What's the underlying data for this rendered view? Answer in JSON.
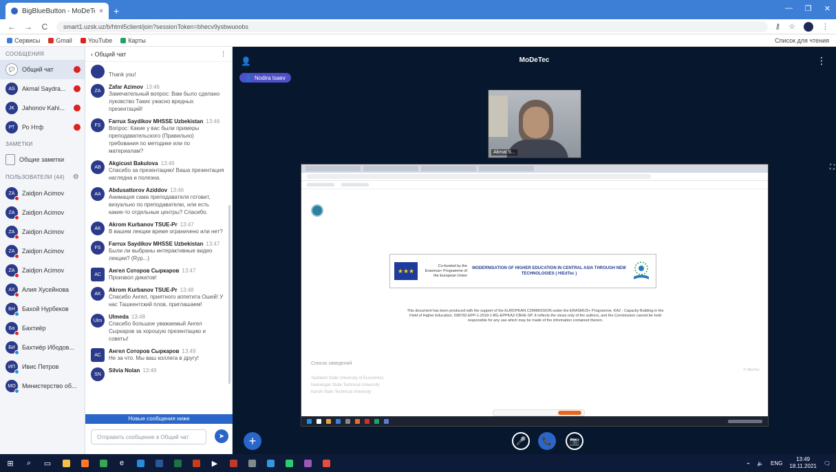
{
  "browser": {
    "tab_title": "BigBlueButton - MoDeTec",
    "tab_close": "×",
    "new_tab": "+",
    "url": "smart1.uzsk.uz/b/html5client/join?sessionToken=bhecv9ysbwuoobs",
    "back": "←",
    "forward": "→",
    "reload": "C",
    "window_controls": [
      "—",
      "❐",
      "✕"
    ],
    "bookmarks": [
      {
        "label": "Сервисы",
        "color": "#3b7ddd"
      },
      {
        "label": "Gmail",
        "color": "#d93025"
      },
      {
        "label": "YouTube",
        "color": "#e02020"
      },
      {
        "label": "Карты",
        "color": "#1ea362"
      }
    ],
    "bookmarks_right": "Список для чтения"
  },
  "sidebar": {
    "messages_header": "СООБЩЕНИЯ",
    "chats": [
      {
        "label": "Общий чат",
        "initials": "",
        "active": true
      },
      {
        "label": "Akmal Saydra...",
        "initials": "AS",
        "active": false
      },
      {
        "label": "Jahonov Kahi...",
        "initials": "JK",
        "active": false
      },
      {
        "label": "Ро Нтф",
        "initials": "РТ",
        "active": false
      }
    ],
    "notes_header": "ЗАМЕТКИ",
    "notes_item": "Общие заметки",
    "users_header": "ПОЛЬЗОВАТЕЛИ (44)",
    "users": [
      {
        "label": "Zaidjon Acimov",
        "initials": "ZA",
        "mark": "red"
      },
      {
        "label": "Zaidjon Acimov",
        "initials": "ZA",
        "mark": "red"
      },
      {
        "label": "Zaidjon Acimov",
        "initials": "ZA",
        "mark": "red"
      },
      {
        "label": "Zaidjon Acimov",
        "initials": "ZA",
        "mark": "red"
      },
      {
        "label": "Zaidjon Acimov",
        "initials": "ZA",
        "mark": "red"
      },
      {
        "label": "Алия Хусейнова",
        "initials": "АХ",
        "mark": "red"
      },
      {
        "label": "Бахой Нурбеков",
        "initials": "БН",
        "mark": "blue"
      },
      {
        "label": "Бахтиёр",
        "initials": "Ба",
        "mark": "red"
      },
      {
        "label": "Бахтиёр Ибодов...",
        "initials": "БИ",
        "mark": "blue"
      },
      {
        "label": "Ивис Петров",
        "initials": "ИП",
        "mark": "blue"
      },
      {
        "label": "Министерство об...",
        "initials": "МО",
        "mark": "blue"
      }
    ]
  },
  "chat": {
    "header": "‹ Общий чат",
    "menu": "⋮",
    "messages": [
      {
        "name": "",
        "initials": "",
        "time": "",
        "text": "Thank you!",
        "square": false
      },
      {
        "name": "Zafar Azimov",
        "initials": "ZA",
        "time": "13:46",
        "text": "Замечательный вопрос: Вам было сделано луковство Таких ужасно вредных презентаций!",
        "square": false
      },
      {
        "name": "Farrux Saydikov MHSSE Uzbekistan",
        "initials": "FS",
        "time": "13:46",
        "text": "Вопрос: Какие у вас были примеры преподавательского (Правильно) требования по методике или по материалам?",
        "square": false
      },
      {
        "name": "Akgicust Bakulova",
        "initials": "AB",
        "time": "13:46",
        "text": "Спасибо за презентацию! Ваша презентация наглядна и полезна.",
        "square": false
      },
      {
        "name": "Abdusattorov Aziddov",
        "initials": "AA",
        "time": "13:46",
        "text": "Анимация сама преподавателя готовит, визуально по преподавателю, или есть какие-то отдельные центры? Спасибо.",
        "square": false
      },
      {
        "name": "Akrom Kurbanov TSUE-Pr",
        "initials": "AK",
        "time": "13:47",
        "text": "В вашем лекции время ограничено или нет?",
        "square": false
      },
      {
        "name": "Farrux Saydikov MHSSE Uzbekistan",
        "initials": "FS",
        "time": "13:47",
        "text": "Были ли выбраны интерактивные видео лекции? (Ryp...)",
        "square": false
      },
      {
        "name": "Ангел Соторов Сыркаров",
        "initials": "АС",
        "time": "13:47",
        "text": "Произвол дикатов!",
        "square": true
      },
      {
        "name": "Akrom Kurbanov TSUE-Pr",
        "initials": "AK",
        "time": "13:48",
        "text": "Спасибо Ангел, приятного аппетита Ошей! У нас Ташкентский плов, приглашаем!",
        "square": false
      },
      {
        "name": "Ulmeda",
        "initials": "Ulm",
        "time": "13:48",
        "text": "Спасибо большое уважаемый Ангел Сыркаров за хорошую презентацию и советы!",
        "square": false
      },
      {
        "name": "Ангел Соторов Сыркаров",
        "initials": "АС",
        "time": "13:49",
        "text": "Не за что. Мы ваш коллега в другу!",
        "square": true
      },
      {
        "name": "Silvia Nolan",
        "initials": "SN",
        "time": "13:49",
        "text": "",
        "square": false
      }
    ],
    "new_messages_bar": "Новые сообщения ниже",
    "composer_placeholder": "Отправить сообщение в Общий чат",
    "send_icon": "➤"
  },
  "stage": {
    "title": "MoDeTec",
    "presenter_badge": "Nodira Isaev",
    "users_icon": "👤",
    "kebab": "⋮",
    "webcam_label": "Akmal S...",
    "fullscreen_icon": "⛶",
    "plus_button": "+",
    "controls": [
      {
        "icon": "🎤",
        "style": "outline"
      },
      {
        "icon": "📞",
        "style": "filled"
      },
      {
        "icon": "📷",
        "style": "outline"
      }
    ]
  },
  "shared_screen": {
    "eu_flag": "★★★",
    "eu_text": "Co-funded by the Erasmus+ Programme of the European Union",
    "project_title": "MODERNISATION OF HIGHER EDUCATION IN CENTRAL ASIA THROUGH NEW TECHNOLOGIES ( HiEdTec )",
    "disclaimer": "This document has been produced with the support of the EUROPEAN COMMISSION under the ERASMUS+ Programme, KA2 - Capacity Building in the Field of Higher Education. 598792-EPP-1-2018-1-BG-EPPKA2-CBHE-SP. It reflects the views only of the authors, and the Commission cannot be held responsible for any use which may be made of the information contained therein.",
    "faded_head": "Список заведений",
    "faded_right": "© HiEdTec",
    "faded_list": [
      "Tashkent State University of Economics",
      "Namangan State Technical University",
      "Karshi State Technical University"
    ]
  },
  "taskbar": {
    "time": "13:49",
    "date": "18.11.2021",
    "lang": "ENG",
    "icons": [
      {
        "name": "search-icon",
        "glyph": "⌕",
        "color": ""
      },
      {
        "name": "task-view-icon",
        "glyph": "▭",
        "color": ""
      },
      {
        "name": "explorer-icon",
        "glyph": "",
        "color": "#f5c04a"
      },
      {
        "name": "firefox-icon",
        "glyph": "",
        "color": "#ff7a2b"
      },
      {
        "name": "chrome-icon",
        "glyph": "",
        "color": "#34a853"
      },
      {
        "name": "edge-icon",
        "glyph": "e",
        "color": ""
      },
      {
        "name": "store-icon",
        "glyph": "",
        "color": "#2c8ad8"
      },
      {
        "name": "word-icon",
        "glyph": "",
        "color": "#2b579a"
      },
      {
        "name": "excel-icon",
        "glyph": "",
        "color": "#1f7244"
      },
      {
        "name": "powerpoint-icon",
        "glyph": "",
        "color": "#c43e1c"
      },
      {
        "name": "media-player-icon",
        "glyph": "▶",
        "color": ""
      },
      {
        "name": "app-icon",
        "glyph": "",
        "color": "#c0392b"
      },
      {
        "name": "app-icon",
        "glyph": "",
        "color": "#7f8c8d"
      },
      {
        "name": "app-icon",
        "glyph": "",
        "color": "#3498db"
      },
      {
        "name": "app-icon",
        "glyph": "",
        "color": "#2ecc71"
      },
      {
        "name": "app-icon",
        "glyph": "",
        "color": "#9b59b6"
      },
      {
        "name": "app-icon",
        "glyph": "",
        "color": "#e74c3c"
      }
    ]
  },
  "colors": {
    "accent": "#2a66c9",
    "stage_bg": "#06172e",
    "presenter": "#4f50c7",
    "notification": "#d22222"
  }
}
